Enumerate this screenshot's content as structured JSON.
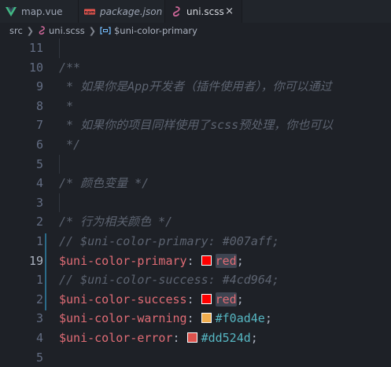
{
  "tabs": [
    {
      "label": "map.vue",
      "italic": false,
      "active": false
    },
    {
      "label": "package.json",
      "italic": true,
      "active": false
    },
    {
      "label": "uni.scss",
      "italic": false,
      "active": true
    }
  ],
  "tab_close_symbol": "×",
  "breadcrumb": {
    "folder": "src",
    "file": "uni.scss",
    "symbol": "$uni-color-primary"
  },
  "lines": [
    {
      "num": "11",
      "text": ""
    },
    {
      "num": "10",
      "text": "/**"
    },
    {
      "num": "9",
      "text": " * 如果你是App开发者（插件使用者），你可以通过"
    },
    {
      "num": "8",
      "text": " *"
    },
    {
      "num": "7",
      "text": " * 如果你的项目同样使用了scss预处理，你也可以"
    },
    {
      "num": "6",
      "text": " */"
    },
    {
      "num": "5",
      "text": ""
    },
    {
      "num": "4",
      "text": "/* 颜色变量 */"
    },
    {
      "num": "3",
      "text": ""
    },
    {
      "num": "2",
      "text": "/* 行为相关颜色 */"
    },
    {
      "num": "1",
      "text": "// $uni-color-primary: #007aff;"
    },
    {
      "num": "19",
      "var": "$uni-color-primary",
      "colon": ":",
      "value": "red",
      "semi": ";",
      "swatch": "#ff0000"
    },
    {
      "num": "1",
      "text": "// $uni-color-success: #4cd964;"
    },
    {
      "num": "2",
      "var": "$uni-color-success",
      "colon": ":",
      "value": "red",
      "semi": ";",
      "swatch": "#ff0000"
    },
    {
      "num": "3",
      "var": "$uni-color-warning",
      "colon": ":",
      "value": "#f0ad4e",
      "semi": ";",
      "swatch": "#f0ad4e"
    },
    {
      "num": "4",
      "var": "$uni-color-error",
      "colon": ":",
      "value": "#dd524d",
      "semi": ";",
      "swatch": "#dd524d"
    },
    {
      "num": "5",
      "text": ""
    }
  ],
  "colors": {
    "editor_bg": "#1e2127",
    "comment": "#5c6370",
    "variable": "#e06c75",
    "value": "#56b6c2",
    "vue_icon": "#42b883",
    "json_icon": "#e8554e",
    "scss_icon": "#cd6799"
  },
  "icons": {
    "vue": "vue-file-icon",
    "json": "json-file-icon",
    "scss": "scss-file-icon",
    "symbol": "variable-symbol-icon",
    "chevron": "chevron-right-icon"
  }
}
